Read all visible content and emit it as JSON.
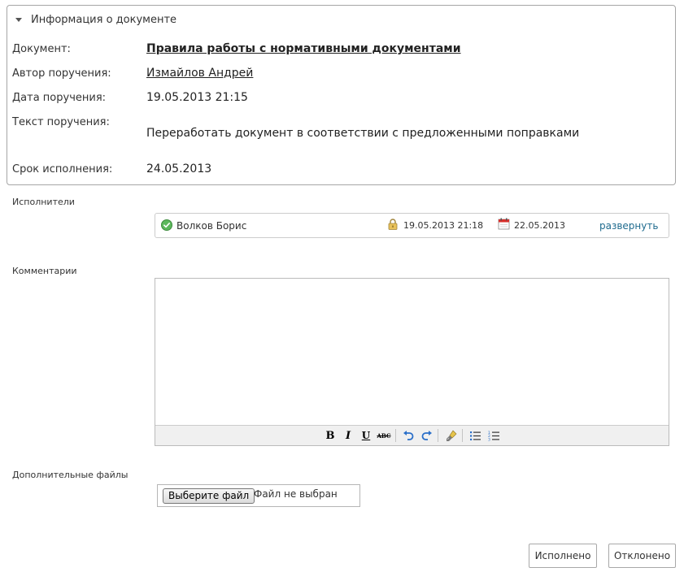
{
  "info_panel": {
    "title": "Информация о документе",
    "fields": {
      "document_label": "Документ:",
      "document_value": "Правила работы с нормативными документами",
      "author_label": "Автор поручения:",
      "author_value": "Измайлов Андрей",
      "date_label": "Дата поручения:",
      "date_value": "19.05.2013 21:15",
      "text_label": "Текст поручения:",
      "text_value": "Переработать документ в соответствии с предложенными поправками",
      "deadline_label": "Срок исполнения:",
      "deadline_value": "24.05.2013"
    }
  },
  "executors": {
    "label": "Исполнители",
    "items": [
      {
        "name": "Волков Борис",
        "start": "19.05.2013 21:18",
        "due": "22.05.2013",
        "expand_label": "развернуть",
        "status_icon": "check-circle-icon"
      }
    ]
  },
  "comments": {
    "label": "Комментарии",
    "value": "",
    "toolbar": [
      "bold-icon",
      "italic-icon",
      "underline-icon",
      "strikethrough-icon",
      "undo-icon",
      "redo-icon",
      "clear-format-icon",
      "bullet-list-icon",
      "numbered-list-icon"
    ]
  },
  "files": {
    "label": "Дополнительные файлы",
    "button_label": "Выберите файл",
    "status": "Файл не выбран"
  },
  "actions": {
    "done_label": "Исполнено",
    "reject_label": "Отклонено"
  },
  "colors": {
    "link": "#1f6b8e",
    "check": "#4caf50"
  }
}
